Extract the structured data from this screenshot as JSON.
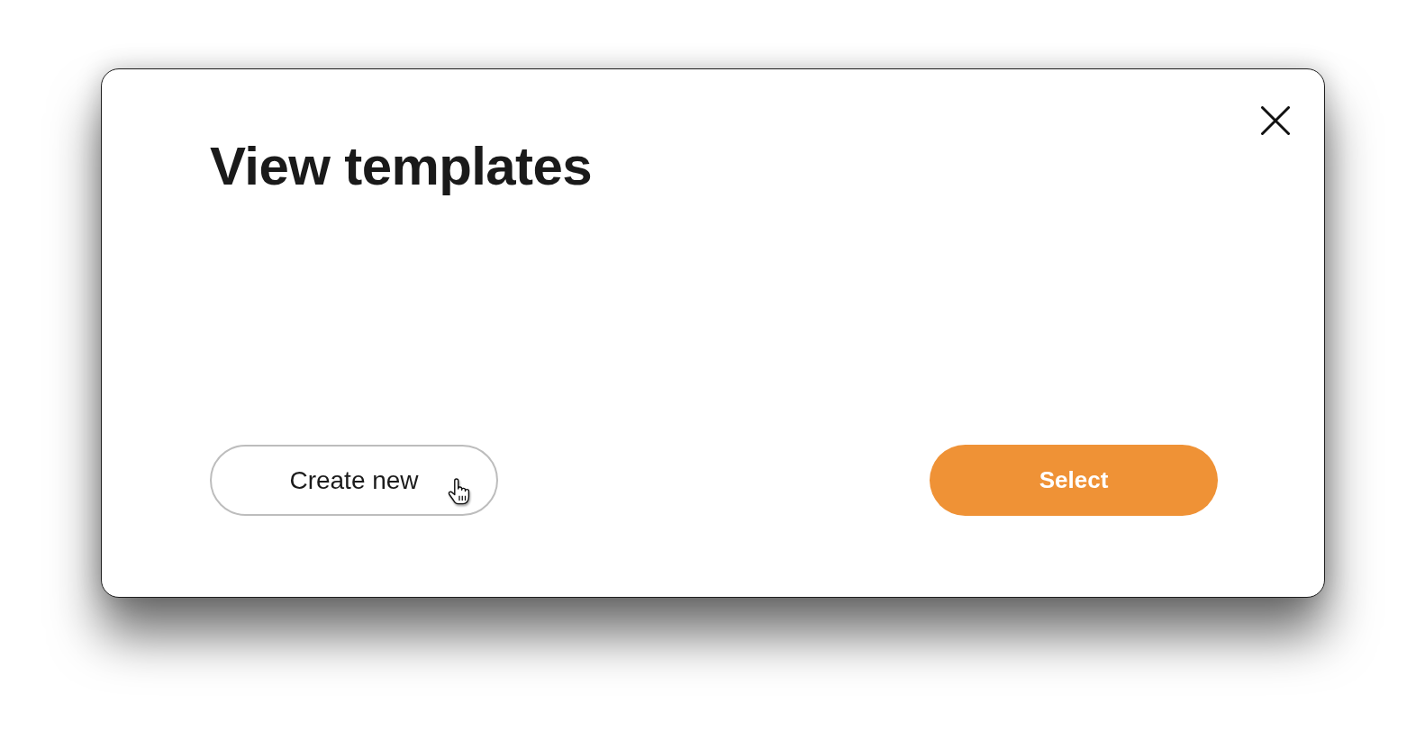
{
  "dialog": {
    "title": "View templates",
    "buttons": [
      {
        "label": "Create new",
        "kind": "secondary",
        "hovered": true
      },
      {
        "label": "Select",
        "kind": "primary",
        "hovered": false
      }
    ]
  }
}
